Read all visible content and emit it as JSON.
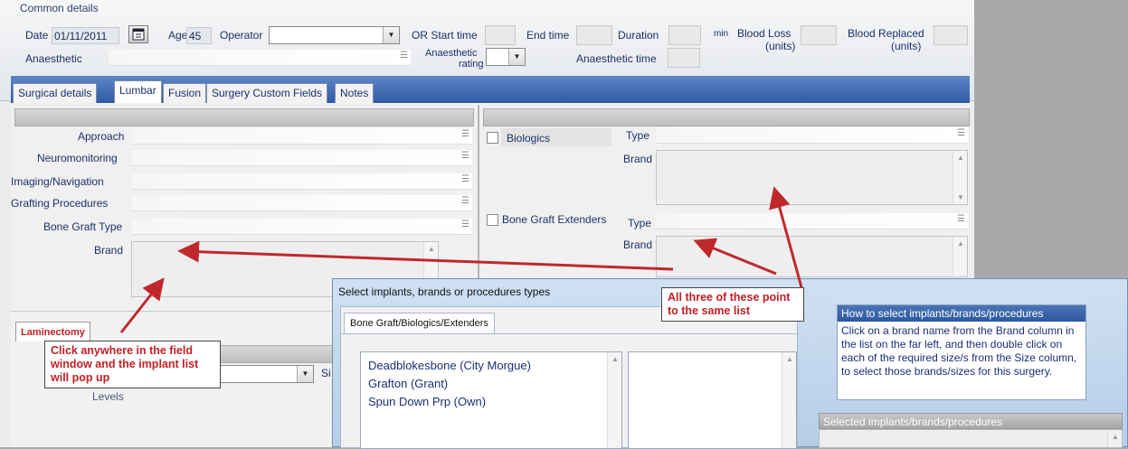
{
  "common": {
    "section_title": "Common details",
    "date_label": "Date",
    "date_value": "01/11/2011",
    "age_label": "Age",
    "age_value": "45",
    "operator_label": "Operator",
    "or_start_label": "OR Start time",
    "end_time_label": "End time",
    "duration_label": "Duration",
    "min_label": "min",
    "blood_loss_label": "Blood Loss",
    "blood_loss_units": "(units)",
    "blood_replaced_label": "Blood Replaced",
    "blood_replaced_units": "(units)",
    "anaesthetic_label": "Anaesthetic",
    "anaesthetic_rating_label1": "Anaesthetic",
    "anaesthetic_rating_label2": "rating",
    "anaesthetic_time_label": "Anaesthetic time"
  },
  "tabs": [
    "Surgical details",
    "Lumbar",
    "Fusion",
    "Surgery Custom Fields",
    "Notes"
  ],
  "left_fields": {
    "approach": "Approach",
    "neuromonitoring": "Neuromonitoring",
    "imaging": "Imaging/Navigation",
    "grafting": "Grafting Procedures",
    "bone_graft_type": "Bone Graft Type",
    "brand": "Brand"
  },
  "right_fields": {
    "biologics": "Biologics",
    "type1": "Type",
    "brand1": "Brand",
    "extenders": "Bone Graft Extenders",
    "type2": "Type",
    "brand2": "Brand"
  },
  "lower_left": {
    "tab": "Laminectomy",
    "levels": "Levels",
    "si": "Si"
  },
  "dialog": {
    "title": "Select implants, brands or procedures types",
    "tab": "Bone Graft/Biologics/Extenders",
    "brands": [
      "Deadblokesbone  (City Morgue)",
      "Grafton  (Grant)",
      "Spun Down Prp  (Own)"
    ],
    "how_title": "How to select implants/brands/procedures",
    "how_text": "Click on a brand name from the Brand column in the list on the far left, and then double click on each of the required size/s from the Size column, to select those brands/sizes for this surgery.",
    "selected_title": "Selected implants/brands/procedures"
  },
  "callouts": {
    "left": "Click anywhere in the field window and the implant list will pop up",
    "right": "All three of these point to the same list"
  },
  "colors": {
    "callout_text": "#c21f25",
    "arrow": "#c0282c",
    "tabbar": "#2d5aa3"
  }
}
